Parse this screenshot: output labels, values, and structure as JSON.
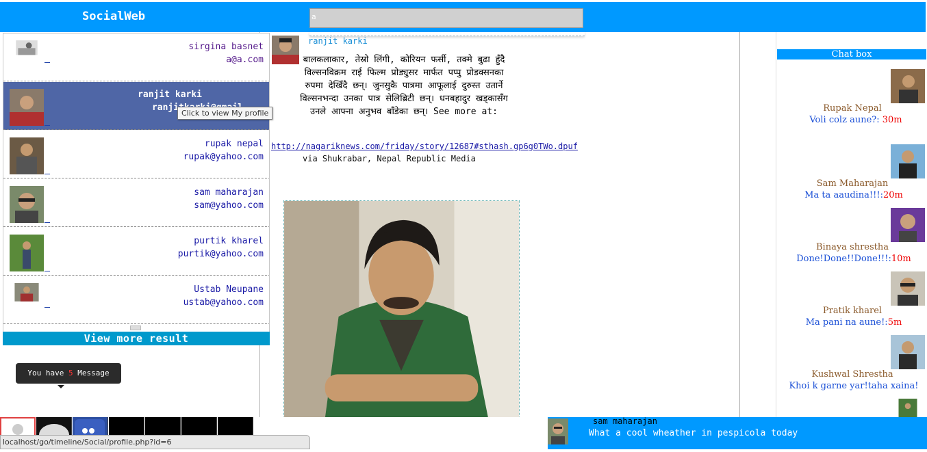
{
  "app": {
    "brand": "SocialWeb"
  },
  "search": {
    "value": "a"
  },
  "results": [
    {
      "name": "sirgina basnet",
      "email": "a@a.com"
    },
    {
      "name": "ranjit karki",
      "email": "ranjitkarki@gmail"
    },
    {
      "name": "rupak nepal",
      "email": "rupak@yahoo.com"
    },
    {
      "name": "sam maharajan",
      "email": "sam@yahoo.com"
    },
    {
      "name": "purtik kharel",
      "email": "purtik@yahoo.com"
    },
    {
      "name": "Ustab Neupane",
      "email": "ustab@yahoo.com"
    }
  ],
  "view_more": "View more result",
  "tooltip": "Click to view My profile",
  "messages": {
    "prefix": "You have",
    "count": "5",
    "suffix": "Message"
  },
  "post": {
    "author": "ranjit karki",
    "lines": [
      "बालकलाकार, तेस्रो लिंगी, कोरियन फर्सी, तक्मे बुढा हुँदै",
      "विल्सनविक्रम राई फिल्म प्रोड्युसर मार्फत पप्पु प्रोडक्सनका",
      "रुपमा देखिँदै छन्। जुनसुकै पात्रमा आफूलाई दुरुस्त उतार्ने",
      "विल्सनभन्दा उनका पात्र सेलिब्रिटी छन्। धनबहादुर खड्कासँग",
      "उनले आफ्ना अनुभव बाँडेका छन्। See more at:"
    ],
    "link": "http://nagariknews.com/friday/story/12687#sthash.gp6g0TWo.dpuf",
    "via": "via Shukrabar, Nepal Republic Media"
  },
  "chat": {
    "title": "Chat box",
    "items": [
      {
        "name": "Rupak Nepal",
        "msg": "Voli colz aune?:",
        "time": "30m"
      },
      {
        "name": "Sam Maharajan",
        "msg": "Ma ta aaudina!!!:",
        "time": "20m"
      },
      {
        "name": "Binaya shrestha",
        "msg": "Done!Done!!Done!!!:",
        "time": "10m"
      },
      {
        "name": "Pratik kharel",
        "msg": "Ma pani na aune!:",
        "time": "5m"
      },
      {
        "name": "Kushwal Shrestha",
        "msg": "Khoi k garne yar!taha xaina!",
        "time": ""
      }
    ]
  },
  "status_url": "localhost/go/timeline/Social/profile.php?id=6",
  "notification": {
    "name": "sam maharajan",
    "text": "What a cool wheather in pespicola today"
  }
}
